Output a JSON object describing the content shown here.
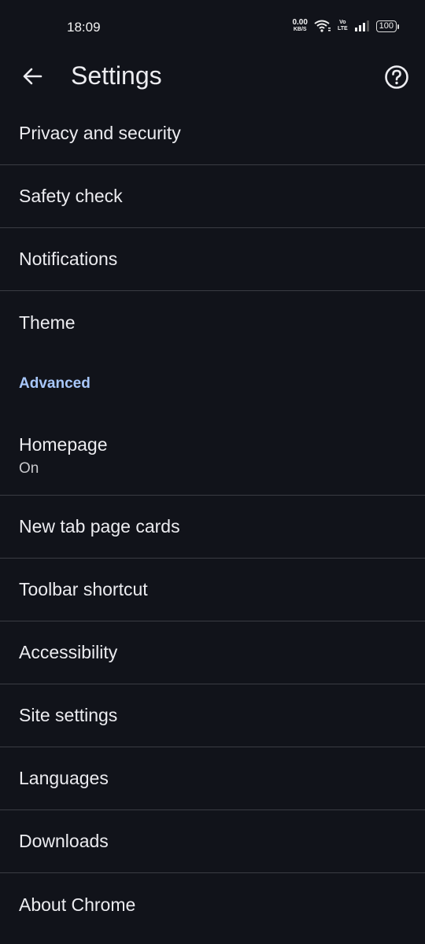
{
  "status_bar": {
    "time": "18:09",
    "net_speed_value": "0.00",
    "net_speed_unit": "KB/S",
    "volte_top": "Vo",
    "volte_bottom": "LTE",
    "battery": "100"
  },
  "app_bar": {
    "title": "Settings",
    "back_icon": "arrow-left-icon",
    "help_icon": "help-circle-icon"
  },
  "items_basic": [
    {
      "label": "Privacy and security"
    },
    {
      "label": "Safety check"
    },
    {
      "label": "Notifications"
    },
    {
      "label": "Theme"
    }
  ],
  "section_advanced": "Advanced",
  "homepage": {
    "label": "Homepage",
    "sub": "On"
  },
  "items_advanced": [
    {
      "label": "New tab page cards"
    },
    {
      "label": "Toolbar shortcut"
    },
    {
      "label": "Accessibility"
    },
    {
      "label": "Site settings"
    },
    {
      "label": "Languages"
    },
    {
      "label": "Downloads"
    },
    {
      "label": "About Chrome"
    }
  ],
  "colors": {
    "background": "#11131a",
    "accent": "#a8c7fa",
    "divider": "#3a3c43"
  }
}
